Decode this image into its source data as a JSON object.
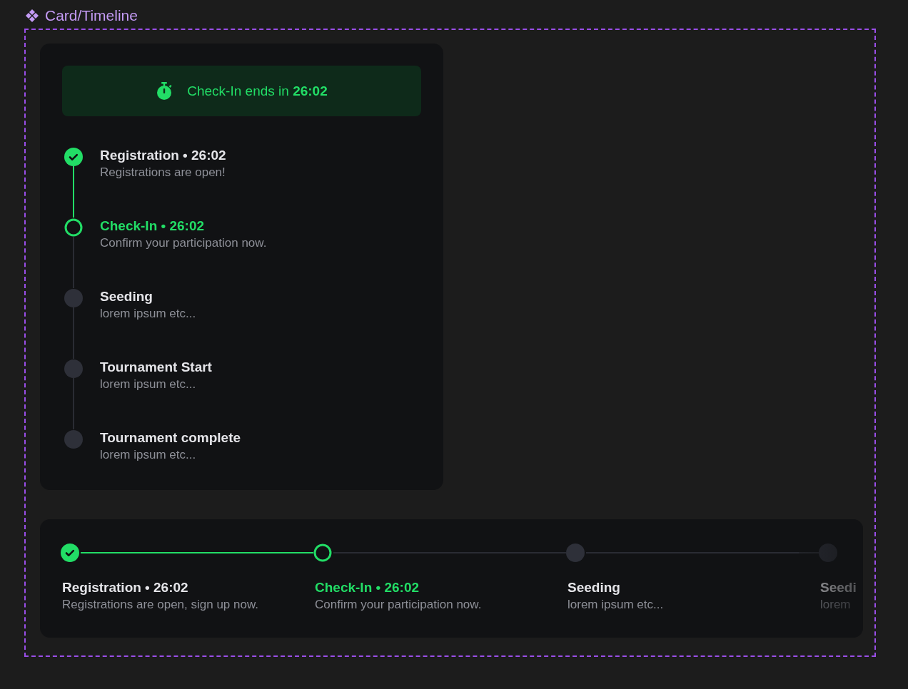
{
  "frame": {
    "title": "Card/Timeline"
  },
  "vertical_timeline": {
    "banner": {
      "text": "Check-In ends in **26:02**"
    },
    "steps": [
      {
        "title": "Registration • 26:02",
        "description": "Registrations are open!",
        "kind": "done"
      },
      {
        "title": "Check-In • 26:02",
        "description": "Confirm your participation now.",
        "kind": "current"
      },
      {
        "title": "Seeding",
        "description": "lorem ipsum etc...",
        "kind": "upcoming"
      },
      {
        "title": "Tournament Start",
        "description": "lorem ipsum etc...",
        "kind": "upcoming"
      },
      {
        "title": "Tournament complete",
        "description": "lorem ipsum etc...",
        "kind": "upcoming"
      }
    ]
  },
  "horizontal_timeline": {
    "steps": [
      {
        "title": "Registration • 26:02",
        "description": "Registrations are open, sign up now.",
        "kind": "done"
      },
      {
        "title": "Check-In • 26:02",
        "description": "Confirm your participation now.",
        "kind": "current"
      },
      {
        "title": "Seeding",
        "description": "lorem ipsum etc...",
        "kind": "upcoming"
      },
      {
        "title": "Seedi",
        "description": "lorem",
        "kind": "upcoming"
      }
    ]
  }
}
